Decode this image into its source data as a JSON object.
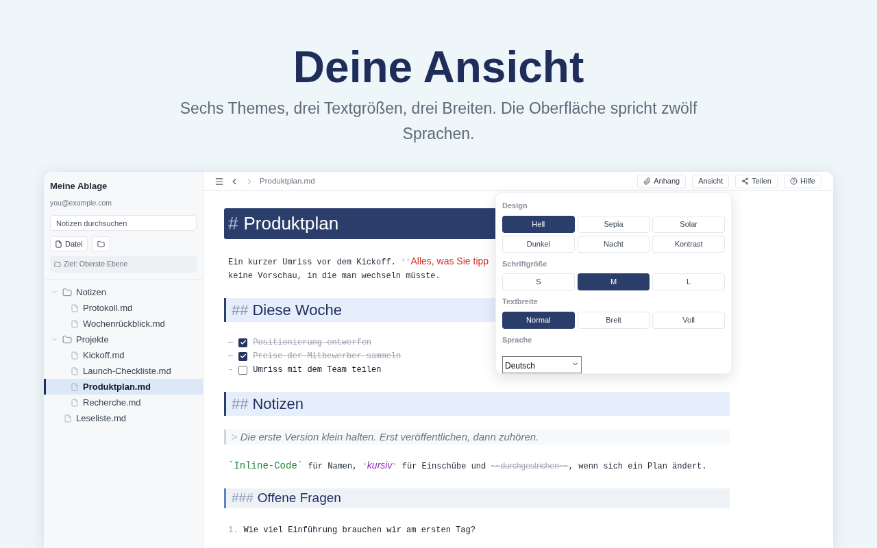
{
  "hero": {
    "title": "Deine Ansicht",
    "subtitle": "Sechs Themes, drei Textgrößen, drei Breiten. Die Oberfläche spricht zwölf Sprachen."
  },
  "sidebar": {
    "title": "Meine Ablage",
    "email": "you@example.com",
    "search": {
      "placeholder": "Notizen durchsuchen"
    },
    "new_file_button": "Datei",
    "target": "Ziel: Oberste Ebene",
    "tree": [
      {
        "kind": "folder",
        "label": "Notizen",
        "expanded": true,
        "selected": false,
        "children": [
          {
            "kind": "file",
            "label": "Protokoll.md",
            "selected": false
          },
          {
            "kind": "file",
            "label": "Wochenrückblick.md",
            "selected": false
          }
        ]
      },
      {
        "kind": "folder",
        "label": "Projekte",
        "expanded": true,
        "selected": false,
        "children": [
          {
            "kind": "file",
            "label": "Kickoff.md",
            "selected": false
          },
          {
            "kind": "file",
            "label": "Launch-Checkliste.md",
            "selected": false
          },
          {
            "kind": "file",
            "label": "Produktplan.md",
            "selected": true
          },
          {
            "kind": "file",
            "label": "Recherche.md",
            "selected": false
          }
        ]
      },
      {
        "kind": "file",
        "label": "Leseliste.md",
        "selected": false
      }
    ]
  },
  "toolbar": {
    "breadcrumb": "Produktplan.md",
    "buttons": [
      {
        "kind": "attach",
        "label": "Anhang"
      },
      {
        "kind": "plain",
        "label": "Ansicht"
      },
      {
        "kind": "share",
        "label": "Teilen"
      },
      {
        "kind": "help",
        "label": "Hilfe"
      }
    ]
  },
  "view_menu": {
    "sections": [
      {
        "title": "Design",
        "options": [
          {
            "label": "Hell",
            "selected": true
          },
          {
            "label": "Sepia",
            "selected": false
          },
          {
            "label": "Solar",
            "selected": false
          },
          {
            "label": "Dunkel",
            "selected": false
          },
          {
            "label": "Nacht",
            "selected": false
          },
          {
            "label": "Kontrast",
            "selected": false
          }
        ]
      },
      {
        "title": "Schriftgröße",
        "options": [
          {
            "label": "S",
            "selected": false
          },
          {
            "label": "M",
            "selected": true
          },
          {
            "label": "L",
            "selected": false
          }
        ]
      },
      {
        "title": "Textbreite",
        "options": [
          {
            "label": "Normal",
            "selected": true
          },
          {
            "label": "Breit",
            "selected": false
          },
          {
            "label": "Voll",
            "selected": false
          }
        ]
      }
    ],
    "language": {
      "title": "Sprache",
      "value": "Deutsch"
    }
  },
  "editor": {
    "blocks": [
      {
        "kind": "h1",
        "marker": "#",
        "text": "Produktplan"
      },
      {
        "kind": "paragraph",
        "lines": [
          [
            {
              "kind": "plain",
              "text": "Ein kurzer Umriss vor dem Kickoff. "
            },
            {
              "kind": "marker",
              "text": "**"
            },
            {
              "kind": "bold",
              "text": "Alles, was Sie tipp"
            }
          ],
          [
            {
              "kind": "plain",
              "text": "keine Vorschau, in die man wechseln müsste."
            }
          ]
        ]
      },
      {
        "kind": "h2",
        "marker": "##",
        "text": "Diese Woche"
      },
      {
        "kind": "task",
        "bullet": "-",
        "checked": true,
        "text": "Positionierung entwerfen"
      },
      {
        "kind": "task",
        "bullet": "-",
        "checked": true,
        "text": "Preise der Mitbewerber sammeln"
      },
      {
        "kind": "task",
        "bullet": "-",
        "checked": false,
        "text": "Umriss mit dem Team teilen"
      },
      {
        "kind": "h2",
        "marker": "##",
        "text": "Notizen"
      },
      {
        "kind": "quote",
        "marker": ">",
        "text": "Die erste Version klein halten. Erst veröffentlichen, dann zuhören."
      },
      {
        "kind": "paragraph",
        "lines": [
          [
            {
              "kind": "code",
              "text": "`Inline-Code`"
            },
            {
              "kind": "plain",
              "text": " für Namen, "
            },
            {
              "kind": "marker",
              "text": "*"
            },
            {
              "kind": "italic",
              "text": "kursiv"
            },
            {
              "kind": "marker",
              "text": "*"
            },
            {
              "kind": "plain",
              "text": " für Einschübe und "
            },
            {
              "kind": "strike",
              "text": "~~durchgestrichen~~"
            },
            {
              "kind": "plain",
              "text": ", wenn sich ein Plan ändert."
            }
          ]
        ]
      },
      {
        "kind": "h3",
        "marker": "###",
        "text": "Offene Fragen"
      },
      {
        "kind": "ordered",
        "number": "1.",
        "text": "Wie viel Einführung brauchen wir am ersten Tag?"
      }
    ]
  }
}
